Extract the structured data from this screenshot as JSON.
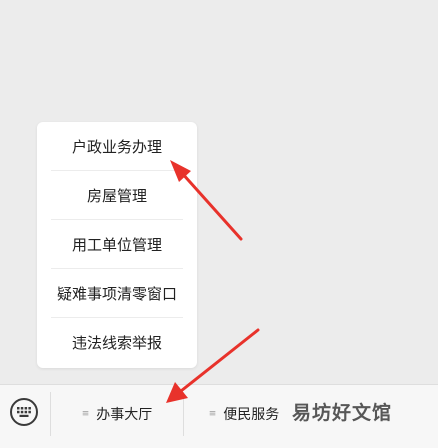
{
  "popup_menu": {
    "items": [
      {
        "label": "户政业务办理"
      },
      {
        "label": "房屋管理"
      },
      {
        "label": "用工单位管理"
      },
      {
        "label": "疑难事项清零窗口"
      },
      {
        "label": "违法线索举报"
      }
    ]
  },
  "bottom_bar": {
    "keyboard_icon": "keyboard-icon",
    "menus": [
      {
        "label": "办事大厅",
        "icon": "menu-lines-icon"
      },
      {
        "label": "便民服务",
        "icon": "menu-lines-icon"
      }
    ]
  },
  "watermark": "易坊好文馆",
  "colors": {
    "arrow": "#e8322b",
    "background": "#ececec",
    "popup": "#ffffff"
  }
}
